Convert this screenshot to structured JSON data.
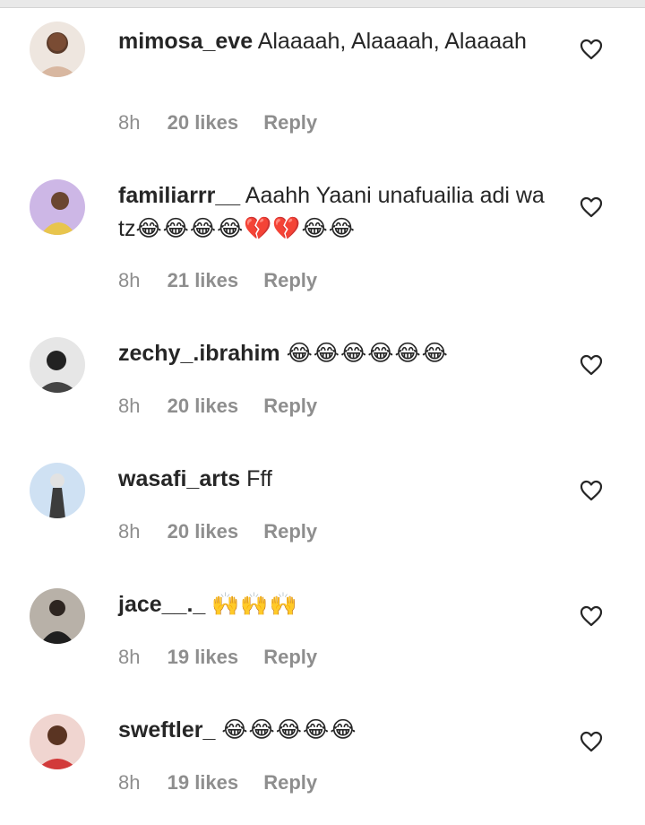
{
  "comments": [
    {
      "username": "mimosa_eve",
      "text": "Alaaaah, Alaaaah, Alaaaah",
      "emoji": "",
      "time": "8h",
      "likes": "20 likes",
      "reply": "Reply",
      "avatar_color": "#e9d7c9"
    },
    {
      "username": "familiarrr__",
      "text": "Aaahh Yaani unafuailia adi wa tz",
      "emoji": "😂😂😂😂💔💔😂😂",
      "time": "8h",
      "likes": "21 likes",
      "reply": "Reply",
      "avatar_color": "#b9a7d8"
    },
    {
      "username": "zechy_.ibrahim",
      "text": "",
      "emoji": "😂😂😂😂😂😂",
      "time": "8h",
      "likes": "20 likes",
      "reply": "Reply",
      "avatar_color": "#d6d6d6"
    },
    {
      "username": "wasafi_arts",
      "text": "Fff",
      "emoji": "",
      "time": "8h",
      "likes": "20 likes",
      "reply": "Reply",
      "avatar_color": "#c9dcef"
    },
    {
      "username": "jace__._",
      "text": "",
      "emoji": "🙌🙌🙌",
      "time": "8h",
      "likes": "19 likes",
      "reply": "Reply",
      "avatar_color": "#a9a39c"
    },
    {
      "username": "sweftler_",
      "text": "",
      "emoji": "😂😂😂😂😂",
      "time": "8h",
      "likes": "19 likes",
      "reply": "Reply",
      "avatar_color": "#e4bdb8"
    }
  ],
  "icons": {
    "like": "heart-outline-icon"
  }
}
